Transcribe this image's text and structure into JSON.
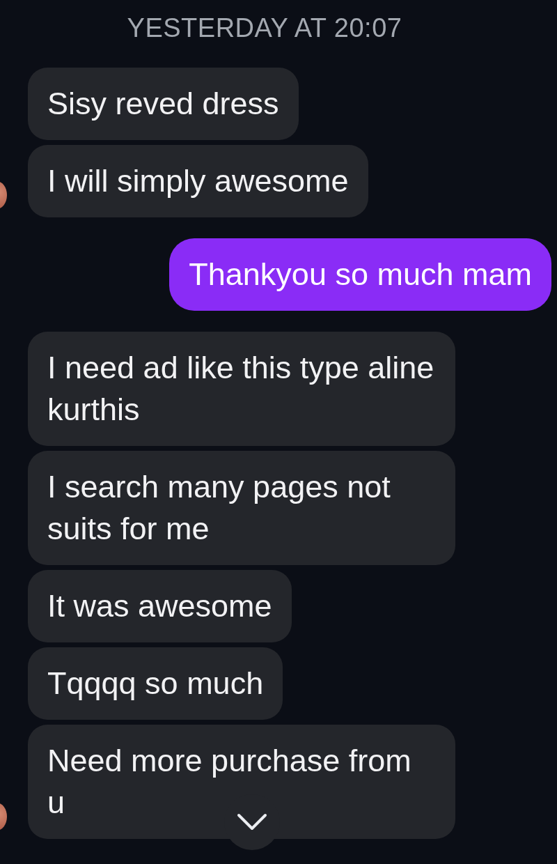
{
  "timestamp": "YESTERDAY AT 20:07",
  "messages": [
    {
      "kind": "received",
      "text": "Sisy reved dress",
      "avatar": false
    },
    {
      "kind": "received",
      "text": "I will simply awesome",
      "avatar": true
    },
    {
      "kind": "sent",
      "text": "Thankyou so much mam",
      "avatar": false
    },
    {
      "kind": "received",
      "text": "I need ad like this type aline kurthis",
      "avatar": false
    },
    {
      "kind": "received",
      "text": "I search many pages not suits for me",
      "avatar": false
    },
    {
      "kind": "received",
      "text": "It was awesome",
      "avatar": false
    },
    {
      "kind": "received",
      "text": "Tqqqq so much",
      "avatar": false
    },
    {
      "kind": "received",
      "text": "Need more purchase from u",
      "avatar": true
    }
  ]
}
